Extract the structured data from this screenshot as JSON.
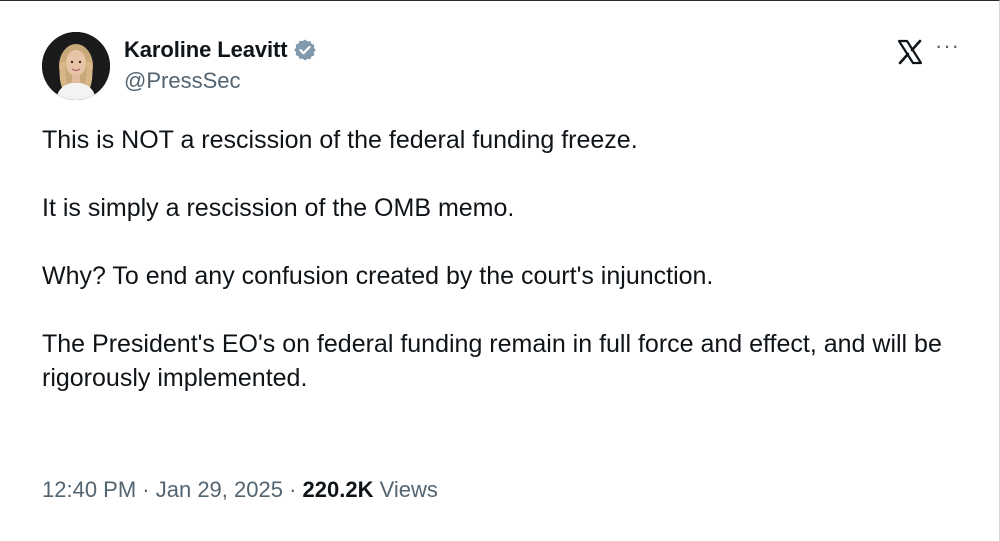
{
  "author": {
    "display_name": "Karoline Leavitt",
    "handle": "@PressSec",
    "verified": true,
    "verified_color": "#829aab"
  },
  "header_icons": {
    "platform_logo": "x-logo-icon",
    "more": "···"
  },
  "tweet": {
    "paragraphs": [
      "This is NOT a rescission of the federal funding freeze.",
      "It is simply a rescission of the OMB memo.",
      "Why? To end any confusion created by the court's injunction.",
      "The President's EO's on federal funding remain in full force and effect, and will be rigorously implemented."
    ]
  },
  "meta": {
    "time": "12:40 PM",
    "separator": " · ",
    "date": "Jan 29, 2025",
    "views_count": "220.2K",
    "views_label": " Views"
  },
  "colors": {
    "text_primary": "#0f1419",
    "text_secondary": "#536471",
    "background": "#ffffff"
  }
}
